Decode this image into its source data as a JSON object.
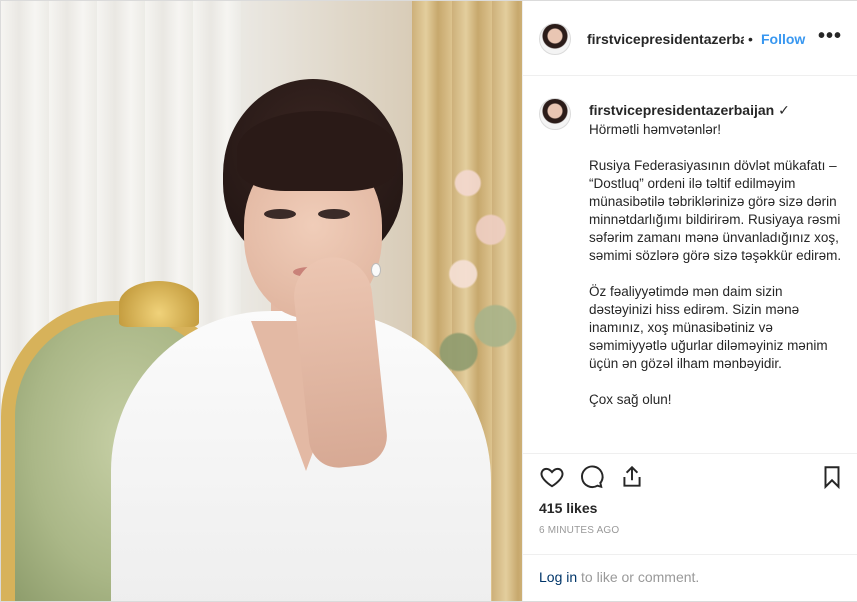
{
  "post": {
    "username": "firstvicepresidentazerbaijan",
    "header_username": "firstvicepresidentazerbaij",
    "verified_badge": "✓",
    "separator": "•",
    "follow_label": "Follow",
    "more_label": "•••",
    "caption": [
      "Hörmətli həmvətənlər!",
      "Rusiya Federasiyasının dövlət mükafatı – “Dostluq” ordeni ilə təltif edilməyim münasibətilə təbriklərinizə görə sizə dərin minnətdarlığımı bildirirəm. Rusiyaya rəsmi səfərim zamanı mənə ünvanladığınız xoş, səmimi sözlərə görə sizə təşəkkür edirəm.",
      "Öz fəaliyyətimdə mən daim sizin dəstəyinizi hiss edirəm. Sizin mənə inamınız, xoş münasibətiniz və səmimiyyətlə uğurlar diləməyiniz mənim üçün ən gözəl ilham mənbəyidir.",
      "Çox sağ olun!"
    ],
    "likes": "415 likes",
    "timestamp": "6 MINUTES AGO",
    "login_link": "Log in",
    "login_suffix": " to like or comment."
  },
  "icons": {
    "like": "heart-icon",
    "comment": "comment-icon",
    "share": "share-icon",
    "save": "bookmark-icon",
    "more": "more-icon"
  },
  "colors": {
    "follow": "#3897f0",
    "link": "#003569",
    "muted": "#999999",
    "text": "#262626",
    "border": "#efefef"
  }
}
